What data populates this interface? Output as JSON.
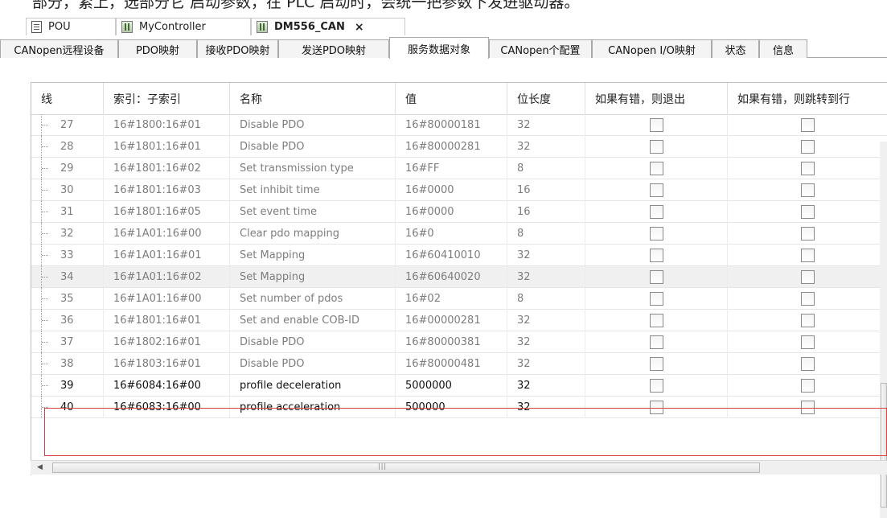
{
  "top_text": "部分，紧上，选部分它  启动参数，在 PLC 启动时，会统一把参数下发进驱动器。",
  "editor_tabs": [
    {
      "label": "POU"
    },
    {
      "label": "MyController"
    },
    {
      "label": "DM556_CAN",
      "close": "×"
    }
  ],
  "sub_tabs": [
    {
      "label": "CANopen远程设备"
    },
    {
      "label": "PDO映射"
    },
    {
      "label": "接收PDO映射"
    },
    {
      "label": "发送PDO映射"
    },
    {
      "label": "服务数据对象"
    },
    {
      "label": "CANopen个配置"
    },
    {
      "label": "CANopen I/O映射"
    },
    {
      "label": "状态"
    },
    {
      "label": "信息"
    }
  ],
  "columns": {
    "line": "线",
    "index": "索引：子索引",
    "name": "名称",
    "value": "值",
    "bitlen": "位长度",
    "abort": "如果有错，则退出",
    "jump": "如果有错，则跳转到行"
  },
  "rows": [
    {
      "line": "27",
      "index": "16#1800:16#01",
      "name": "Disable PDO",
      "value": "16#80000181",
      "bitlen": "32",
      "abort_checked": false,
      "jump_checked": false
    },
    {
      "line": "28",
      "index": "16#1801:16#01",
      "name": "Disable PDO",
      "value": "16#80000281",
      "bitlen": "32",
      "abort_checked": false,
      "jump_checked": false
    },
    {
      "line": "29",
      "index": "16#1801:16#02",
      "name": "Set transmission type",
      "value": "16#FF",
      "bitlen": "8",
      "abort_checked": false,
      "jump_checked": false
    },
    {
      "line": "30",
      "index": "16#1801:16#03",
      "name": "Set inhibit time",
      "value": "16#0000",
      "bitlen": "16",
      "abort_checked": false,
      "jump_checked": false
    },
    {
      "line": "31",
      "index": "16#1801:16#05",
      "name": "Set event time",
      "value": "16#0000",
      "bitlen": "16",
      "abort_checked": false,
      "jump_checked": false
    },
    {
      "line": "32",
      "index": "16#1A01:16#00",
      "name": "Clear pdo mapping",
      "value": "16#0",
      "bitlen": "8",
      "abort_checked": false,
      "jump_checked": false
    },
    {
      "line": "33",
      "index": "16#1A01:16#01",
      "name": "Set Mapping",
      "value": "16#60410010",
      "bitlen": "32",
      "abort_checked": false,
      "jump_checked": false
    },
    {
      "line": "34",
      "index": "16#1A01:16#02",
      "name": "Set Mapping",
      "value": "16#60640020",
      "bitlen": "32",
      "abort_checked": false,
      "jump_checked": false
    },
    {
      "line": "35",
      "index": "16#1A01:16#00",
      "name": "Set number of pdos",
      "value": "16#02",
      "bitlen": "8",
      "abort_checked": false,
      "jump_checked": false
    },
    {
      "line": "36",
      "index": "16#1801:16#01",
      "name": "Set and enable COB-ID",
      "value": "16#00000281",
      "bitlen": "32",
      "abort_checked": false,
      "jump_checked": false
    },
    {
      "line": "37",
      "index": "16#1802:16#01",
      "name": "Disable PDO",
      "value": "16#80000381",
      "bitlen": "32",
      "abort_checked": false,
      "jump_checked": false
    },
    {
      "line": "38",
      "index": "16#1803:16#01",
      "name": "Disable PDO",
      "value": "16#80000481",
      "bitlen": "32",
      "abort_checked": false,
      "jump_checked": false
    },
    {
      "line": "39",
      "index": "16#6084:16#00",
      "name": "profile deceleration",
      "value": "5000000",
      "bitlen": "32",
      "abort_checked": false,
      "jump_checked": false
    },
    {
      "line": "40",
      "index": "16#6083:16#00",
      "name": "profile acceleration",
      "value": "500000",
      "bitlen": "32",
      "abort_checked": false,
      "jump_checked": false
    }
  ],
  "colors": {
    "highlight_border": "#d94040",
    "grey_text": "#7d7d7d",
    "selected_row": "#f0f0f0"
  },
  "icons": [
    "document-icon",
    "controller-icon",
    "device-icon",
    "close-icon",
    "checkbox-icon",
    "scroll-left-icon",
    "scroll-right-icon"
  ]
}
